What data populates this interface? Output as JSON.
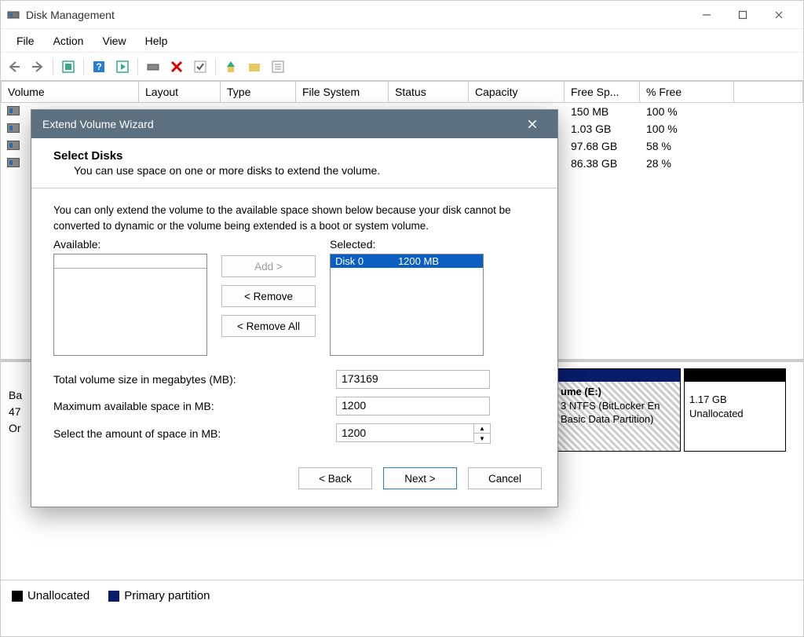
{
  "titlebar": {
    "title": "Disk Management"
  },
  "menu": {
    "file": "File",
    "action": "Action",
    "view": "View",
    "help": "Help"
  },
  "table": {
    "headers": {
      "volume": "Volume",
      "layout": "Layout",
      "type": "Type",
      "fs": "File System",
      "status": "Status",
      "capacity": "Capacity",
      "free": "Free Sp...",
      "pct": "% Free"
    },
    "rows": [
      {
        "free": "150 MB",
        "pct": "100 %"
      },
      {
        "free": "1.03 GB",
        "pct": "100 %"
      },
      {
        "free": "97.68 GB",
        "pct": "58 %"
      },
      {
        "free": "86.38 GB",
        "pct": "28 %"
      }
    ]
  },
  "disk": {
    "info_prefix": "Ba",
    "info_size": "47",
    "info_status": "Or",
    "block_e": {
      "title": "ume  (E:)",
      "line2": "3 NTFS (BitLocker En",
      "line3": "Basic Data Partition)"
    },
    "block_unalloc": {
      "size": "1.17 GB",
      "label": "Unallocated"
    }
  },
  "legend": {
    "unallocated": "Unallocated",
    "primary": "Primary partition"
  },
  "wizard": {
    "title": "Extend Volume Wizard",
    "heading": "Select Disks",
    "subheading": "You can use space on one or more disks to extend the volume.",
    "note": "You can only extend the volume to the available space shown below because your disk cannot be converted to dynamic or the volume being extended is a boot or system volume.",
    "available_label": "Available:",
    "selected_label": "Selected:",
    "add": "Add >",
    "remove": "< Remove",
    "remove_all": "< Remove All",
    "selected_item_disk": "Disk 0",
    "selected_item_size": "1200 MB",
    "total_label": "Total volume size in megabytes (MB):",
    "total_value": "173169",
    "max_label": "Maximum available space in MB:",
    "max_value": "1200",
    "amount_label": "Select the amount of space in MB:",
    "amount_value": "1200",
    "back": "< Back",
    "next": "Next >",
    "cancel": "Cancel"
  }
}
